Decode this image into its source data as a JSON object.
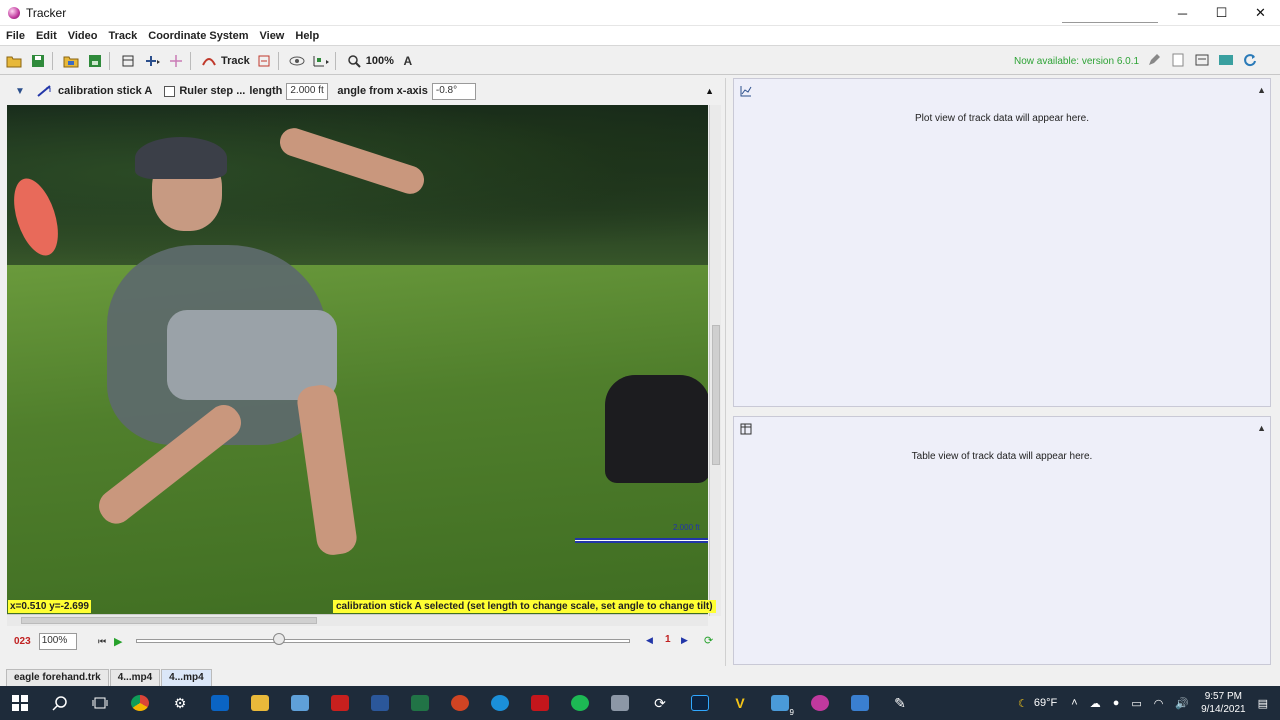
{
  "window": {
    "title": "Tracker",
    "controls": {
      "minimize": "─",
      "maximize": "☐",
      "close": "✕"
    }
  },
  "menubar": [
    "File",
    "Edit",
    "Video",
    "Track",
    "Coordinate System",
    "View",
    "Help"
  ],
  "toolbar": {
    "track_label": "Track",
    "zoom_label": "100%",
    "version_note": "Now available: version 6.0.1"
  },
  "calibration": {
    "tool_name": "calibration stick A",
    "ruler_label": "Ruler step ...",
    "length_label": "length",
    "length_value": "2.000 ft",
    "angle_label": "angle from x-axis",
    "angle_value": "-0.8°"
  },
  "video": {
    "coord_readout": "x=0.510  y=-2.699",
    "status_message": "calibration stick A selected (set length to change scale, set angle to change tilt)",
    "calib_tag": "2.000 ft"
  },
  "player": {
    "frame_number": "023",
    "rate": "100%",
    "slider_fraction": 0.29,
    "step_value": "1"
  },
  "tabs": [
    "eagle forehand.trk",
    "4...mp4",
    "4...mp4"
  ],
  "plot_panel": {
    "message": "Plot view of track data will appear here."
  },
  "table_panel": {
    "message": "Table view of track data will appear here."
  },
  "taskbar": {
    "temperature": "69°F",
    "time": "9:57 PM",
    "date": "9/14/2021",
    "badge": "9",
    "apps": [
      "start-icon",
      "search-icon",
      "task-view-icon",
      "chrome-icon",
      "settings-icon",
      "outlook-icon",
      "file-explorer-icon",
      "store-icon",
      "acrobat-icon",
      "word-icon",
      "excel-icon",
      "powerpoint-icon",
      "skype-icon",
      "sw-icon",
      "spotify-icon",
      "app-icon",
      "sync-icon",
      "photoshop-icon",
      "norton-icon",
      "files-icon",
      "tracker-icon",
      "photos-icon",
      "pen-icon"
    ]
  },
  "colors": {
    "accent_green": "#2ea336",
    "highlight_yellow": "#ffff33",
    "frame_red": "#c02020",
    "panel_bg": "#eeeff9",
    "taskbar_bg": "#1e2b3a"
  }
}
